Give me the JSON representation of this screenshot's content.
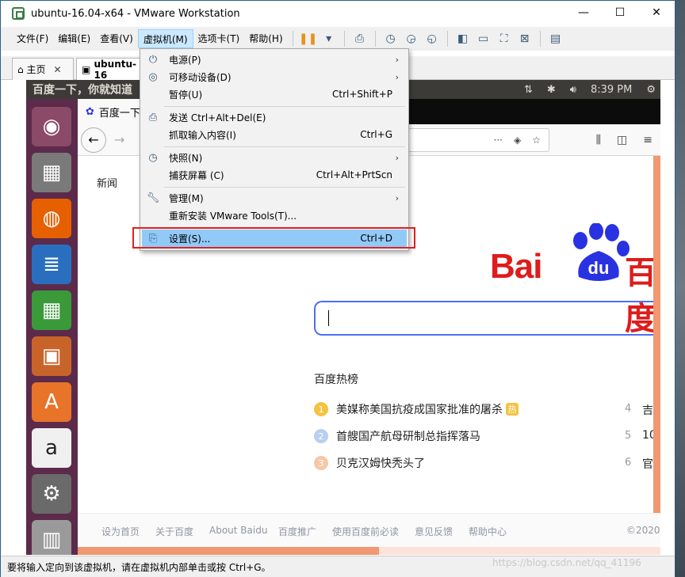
{
  "window": {
    "title": "ubuntu-16.04-x64 - VMware Workstation",
    "minimize": "—",
    "maximize": "☐",
    "close": "✕"
  },
  "menubar": {
    "items": [
      "文件(F)",
      "编辑(E)",
      "查看(V)",
      "虚拟机(M)",
      "选项卡(T)",
      "帮助(H)"
    ],
    "active": "虚拟机(M)"
  },
  "tabs": {
    "home": "主页",
    "vm": "ubuntu-16",
    "close": "✕"
  },
  "vm_menu": {
    "items": [
      {
        "icon": "power-icon",
        "label": "电源(P)",
        "shortcut": "",
        "submenu": true
      },
      {
        "icon": "removable-device-icon",
        "label": "可移动设备(D)",
        "shortcut": "",
        "submenu": true
      },
      {
        "icon": "",
        "label": "暂停(U)",
        "shortcut": "Ctrl+Shift+P",
        "submenu": false
      },
      {
        "icon": "send-keys-icon",
        "label": "发送 Ctrl+Alt+Del(E)",
        "shortcut": "",
        "submenu": false
      },
      {
        "icon": "",
        "label": "抓取输入内容(I)",
        "shortcut": "Ctrl+G",
        "submenu": false
      },
      {
        "icon": "snapshot-icon",
        "label": "快照(N)",
        "shortcut": "",
        "submenu": true
      },
      {
        "icon": "",
        "label": "捕获屏幕 (C)",
        "shortcut": "Ctrl+Alt+PrtScn",
        "submenu": false
      },
      {
        "icon": "wrench-icon",
        "label": "管理(M)",
        "shortcut": "",
        "submenu": true
      },
      {
        "icon": "",
        "label": "重新安装 VMware Tools(T)...",
        "shortcut": "",
        "submenu": false
      },
      {
        "icon": "settings-icon",
        "label": "设置(S)...",
        "shortcut": "Ctrl+D",
        "submenu": false,
        "selected": true
      }
    ]
  },
  "ubuntu": {
    "panel_title": "百度一下，你就知道",
    "time": "8:39 PM"
  },
  "firefox": {
    "tab_title": "百度一下",
    "url_actions": [
      "···"
    ]
  },
  "baidu": {
    "news": "新闻",
    "logo_latin": "Bai",
    "logo_du": "du",
    "logo_cn": "百度",
    "hot_title": "百度热榜",
    "hot_list": [
      {
        "rank": "1",
        "text": "美媒称美国抗疫成国家批准的屠杀",
        "badge": "热",
        "color": "#f5c342"
      },
      {
        "rank": "2",
        "text": "首艘国产航母研制总指挥落马",
        "badge": "",
        "color": "#b8cfee"
      },
      {
        "rank": "3",
        "text": "贝克汉姆快秃头了",
        "badge": "",
        "color": "#f6c8a8"
      }
    ],
    "right_list": [
      {
        "rank": "4",
        "text": "吉"
      },
      {
        "rank": "5",
        "text": "10"
      },
      {
        "rank": "6",
        "text": "官"
      }
    ],
    "footer": [
      "设为首页",
      "关于百度",
      "About Baidu",
      "百度推广",
      "使用百度前必读",
      "意见反馈",
      "帮助中心",
      "©2020"
    ]
  },
  "status": {
    "message": "要将输入定向到该虚拟机，请在虚拟机内部单击或按 Ctrl+G。",
    "watermark": "https://blog.csdn.net/qq_41196"
  }
}
